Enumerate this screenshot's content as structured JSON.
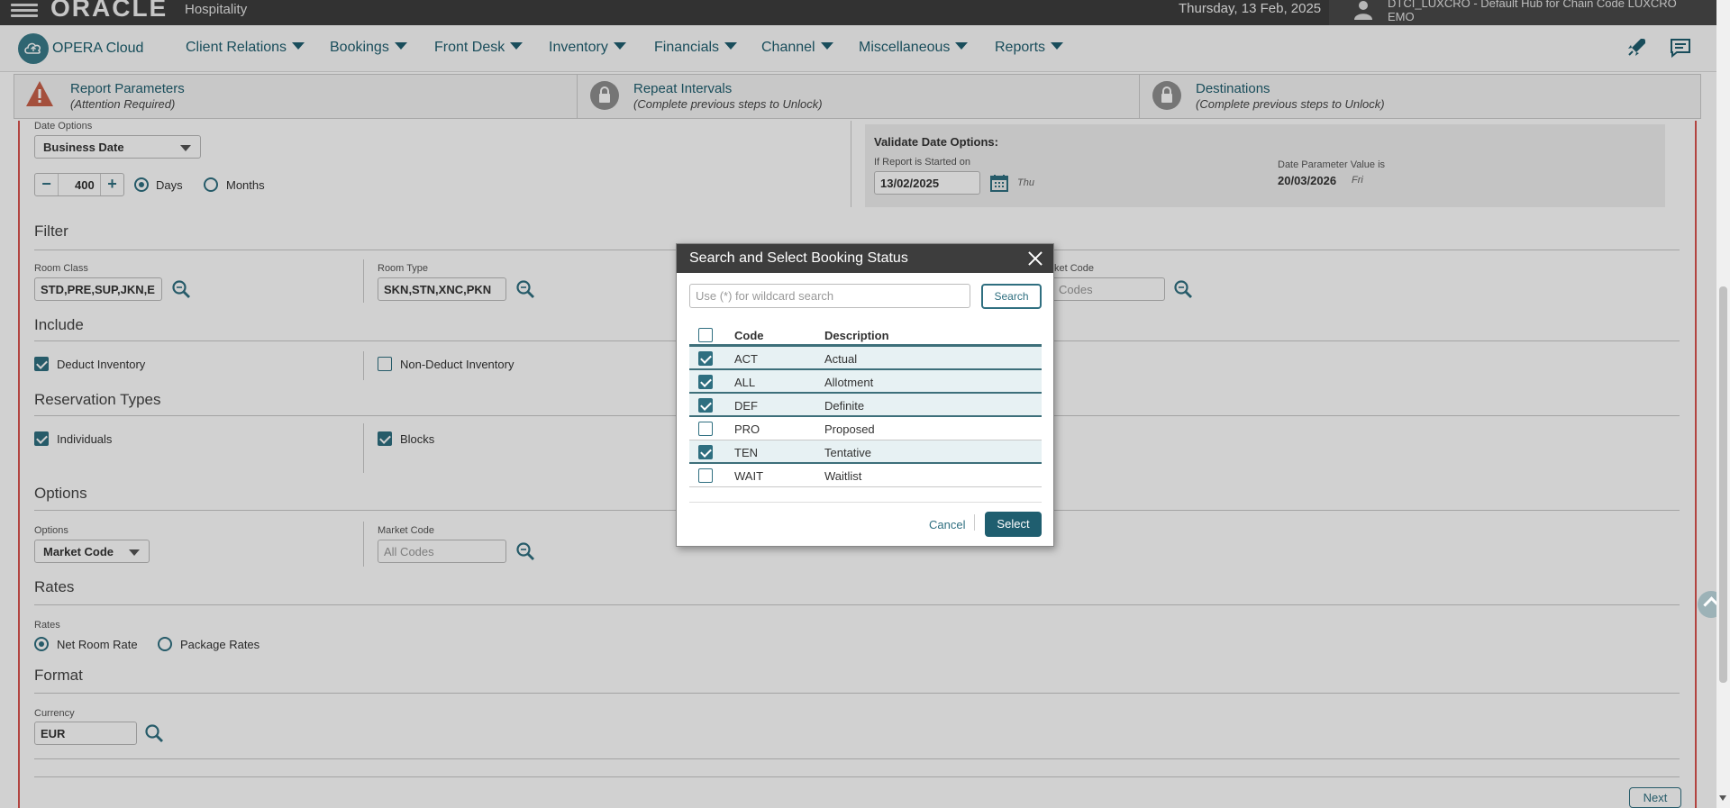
{
  "topbar": {
    "brand": "ORACLE",
    "product": "Hospitality",
    "date": "Thursday, 13 Feb, 2025",
    "user_line1": "DTCI_LUXCRO - Default Hub for Chain Code LUXCRO",
    "user_line2": "EMO"
  },
  "nav": {
    "app_title": "OPERA Cloud",
    "items": [
      "Client Relations",
      "Bookings",
      "Front Desk",
      "Inventory",
      "Financials",
      "Channel",
      "Miscellaneous",
      "Reports"
    ]
  },
  "steps": [
    {
      "title": "Report Parameters",
      "subtitle": "(Attention Required)",
      "icon": "warning-icon"
    },
    {
      "title": "Repeat Intervals",
      "subtitle": "(Complete previous steps to Unlock)",
      "icon": "lock-icon"
    },
    {
      "title": "Destinations",
      "subtitle": "(Complete previous steps to Unlock)",
      "icon": "lock-icon"
    }
  ],
  "form": {
    "date_options_label": "Date Options",
    "date_options_value": "Business Date",
    "stepper_value": "400",
    "days_label": "Days",
    "months_label": "Months",
    "validate_title": "Validate Date Options:",
    "started_on_label": "If Report is Started on",
    "started_on_value": "13/02/2025",
    "started_on_day": "Thu",
    "param_value_label": "Date Parameter Value is",
    "param_value": "20/03/2026",
    "param_day": "Fri",
    "filter_title": "Filter",
    "room_class_label": "Room Class",
    "room_class_value": "STD,PRE,SUP,JKN,E",
    "room_type_label": "Room Type",
    "room_type_value": "SKN,STN,XNC,PKN",
    "market_code_label_partial": "ket Code",
    "market_code_ph_partial": "Codes",
    "include_title": "Include",
    "deduct_label": "Deduct Inventory",
    "non_deduct_label": "Non-Deduct Inventory",
    "res_types_title": "Reservation Types",
    "individuals_label": "Individuals",
    "blocks_label": "Blocks",
    "options_title": "Options",
    "options_label": "Options",
    "options_value": "Market Code",
    "market_code_label": "Market Code",
    "market_code_placeholder": "All Codes",
    "rates_title": "Rates",
    "rates_label": "Rates",
    "net_room_rate": "Net Room Rate",
    "package_rates": "Package Rates",
    "format_title": "Format",
    "currency_label": "Currency",
    "currency_value": "EUR",
    "next_label": "Next"
  },
  "dialog": {
    "title": "Search and Select Booking Status",
    "search_placeholder": "Use (*) for wildcard search",
    "search_button": "Search",
    "col_code": "Code",
    "col_desc": "Description",
    "rows": [
      {
        "code": "ACT",
        "desc": "Actual",
        "checked": true
      },
      {
        "code": "ALL",
        "desc": "Allotment",
        "checked": true
      },
      {
        "code": "DEF",
        "desc": "Definite",
        "checked": true
      },
      {
        "code": "PRO",
        "desc": "Proposed",
        "checked": false
      },
      {
        "code": "TEN",
        "desc": "Tentative",
        "checked": true
      },
      {
        "code": "WAIT",
        "desc": "Waitlist",
        "checked": false
      }
    ],
    "cancel_label": "Cancel",
    "select_label": "Select"
  },
  "colors": {
    "accent": "#2f6f80",
    "header": "#3e3e3e",
    "warning": "#d9534f"
  }
}
